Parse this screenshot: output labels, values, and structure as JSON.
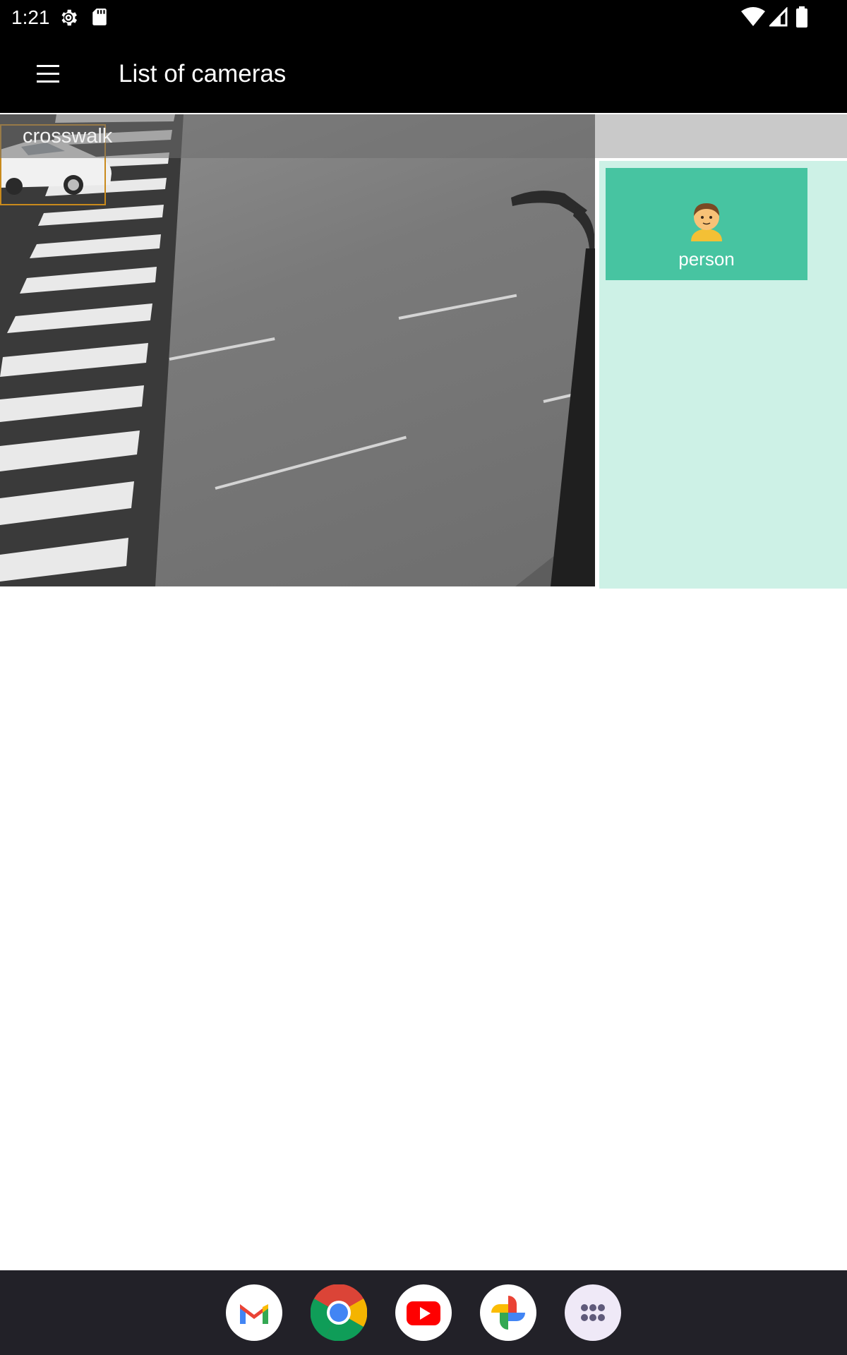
{
  "status_bar": {
    "time": "1:21",
    "icons": [
      "settings-gear-icon",
      "sd-card-icon",
      "wifi-icon",
      "cell-signal-icon",
      "battery-icon"
    ]
  },
  "app_bar": {
    "title": "List of cameras",
    "menu_icon": "hamburger-menu-icon"
  },
  "camera": {
    "name": "crosswalk"
  },
  "detections": [
    {
      "emoji": "🧑",
      "label": "person"
    }
  ],
  "dock": {
    "apps": [
      "Gmail",
      "Chrome",
      "YouTube",
      "Photos",
      "App drawer"
    ]
  },
  "colors": {
    "app_bar": "#000000",
    "detection_card": "#47c4a1",
    "detection_panel": "#cdf1e6",
    "dock": "#222128"
  }
}
